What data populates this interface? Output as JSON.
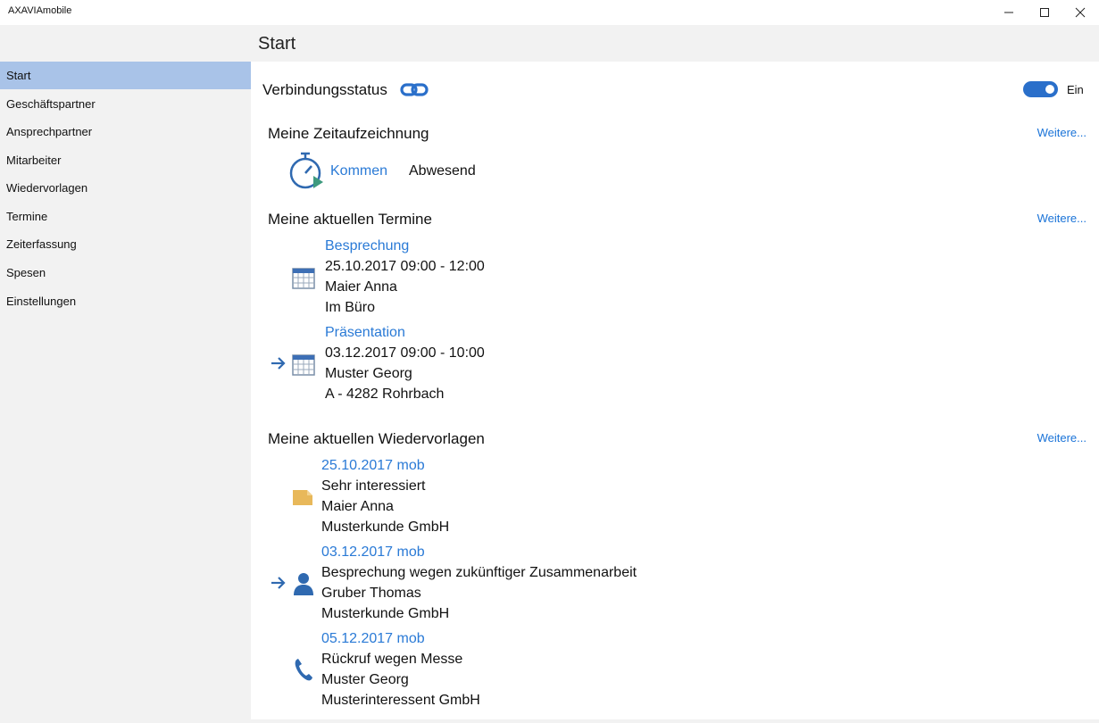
{
  "window": {
    "title": "AXAVIAmobile",
    "controls": {
      "minimize": "minimize-icon",
      "maximize": "maximize-icon",
      "close": "close-icon"
    }
  },
  "header": {
    "title": "Start"
  },
  "sidebar": {
    "items": [
      {
        "label": "Start",
        "active": true
      },
      {
        "label": "Geschäftspartner"
      },
      {
        "label": "Ansprechpartner"
      },
      {
        "label": "Mitarbeiter"
      },
      {
        "label": "Wiedervorlagen"
      },
      {
        "label": "Termine"
      },
      {
        "label": "Zeiterfassung"
      },
      {
        "label": "Spesen"
      },
      {
        "label": "Einstellungen"
      }
    ]
  },
  "connection": {
    "label": "Verbindungsstatus",
    "icon": "link-icon",
    "toggle_label": "Ein",
    "on": true
  },
  "time_tracking": {
    "title": "Meine Zeitaufzeichnung",
    "more": "Weitere...",
    "icon": "stopwatch-icon",
    "action": "Kommen",
    "status": "Abwesend"
  },
  "appointments": {
    "title": "Meine aktuellen Termine",
    "more": "Weitere...",
    "items": [
      {
        "title": "Besprechung",
        "time": "25.10.2017 09:00 - 12:00",
        "person": "Maier Anna",
        "location": "Im Büro",
        "icon": "calendar-icon",
        "current": false
      },
      {
        "title": "Präsentation",
        "time": "03.12.2017 09:00 - 10:00",
        "person": "Muster Georg",
        "location": "A - 4282 Rohrbach",
        "icon": "calendar-icon",
        "current": true
      }
    ]
  },
  "followups": {
    "title": "Meine aktuellen Wiedervorlagen",
    "more": "Weitere...",
    "items": [
      {
        "date": "25.10.2017 mob",
        "subject": "Sehr interessiert",
        "person": "Maier Anna",
        "company": "Musterkunde GmbH",
        "icon": "note-icon",
        "current": false
      },
      {
        "date": "03.12.2017 mob",
        "subject": "Besprechung wegen zukünftiger Zusammenarbeit",
        "person": "Gruber Thomas",
        "company": "Musterkunde GmbH",
        "icon": "person-icon",
        "current": true
      },
      {
        "date": "05.12.2017 mob",
        "subject": "Rückruf wegen Messe",
        "person": "Muster Georg",
        "company": "Musterinteressent GmbH",
        "icon": "phone-icon",
        "current": false
      }
    ]
  },
  "colors": {
    "accent": "#2a7ad6",
    "toggle": "#2a6fca",
    "sidebar_active": "#a9c3e8",
    "note": "#e8b85a"
  }
}
